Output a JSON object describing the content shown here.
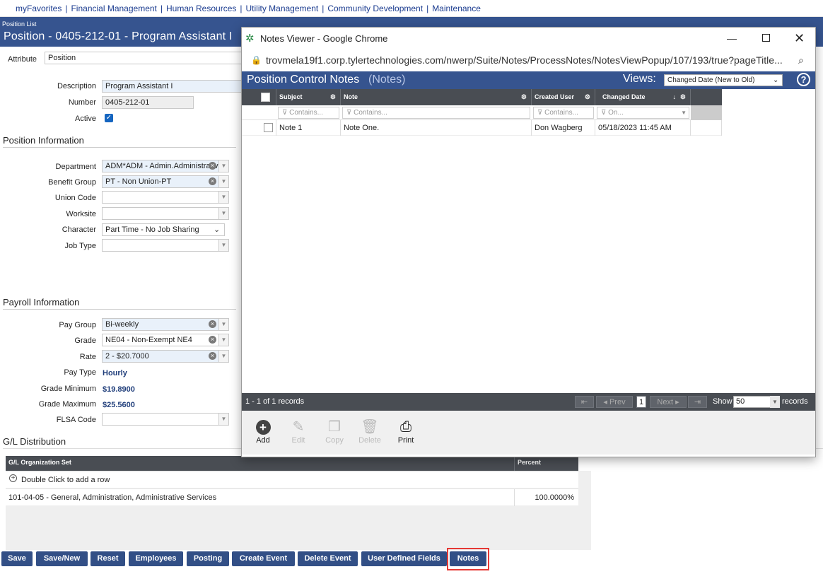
{
  "top_menu": [
    "myFavorites",
    "Financial Management",
    "Human Resources",
    "Utility Management",
    "Community Development",
    "Maintenance"
  ],
  "breadcrumb": "Position List",
  "page_title": "Position - 0405-212-01 - Program Assistant I",
  "attribute": {
    "label": "Attribute",
    "value": "Position"
  },
  "general": {
    "description_label": "Description",
    "description": "Program Assistant I",
    "number_label": "Number",
    "number": "0405-212-01",
    "active_label": "Active"
  },
  "position_info": {
    "heading": "Position Information",
    "department_label": "Department",
    "department": "ADM*ADM - Admin.Administrative",
    "benefit_label": "Benefit Group",
    "benefit": "PT - Non Union-PT",
    "union_label": "Union Code",
    "union": "",
    "worksite_label": "Worksite",
    "worksite": "",
    "character_label": "Character",
    "character": "Part Time - No Job Sharing",
    "jobtype_label": "Job Type",
    "jobtype": ""
  },
  "payroll": {
    "heading": "Payroll Information",
    "paygroup_label": "Pay Group",
    "paygroup": "Bi-weekly",
    "grade_label": "Grade",
    "grade": "NE04 - Non-Exempt NE4",
    "rate_label": "Rate",
    "rate": "2 - $20.7000",
    "paytype_label": "Pay Type",
    "paytype": "Hourly",
    "gradmin_label": "Grade Minimum",
    "gradmin": "$19.8900",
    "gradmax_label": "Grade Maximum",
    "gradmax": "$25.5600",
    "flsa_label": "FLSA Code",
    "flsa": ""
  },
  "gl": {
    "heading": "G/L Distribution",
    "col_org": "G/L Organization Set",
    "col_pct": "Percent",
    "add_row": "Double Click to add a row",
    "row_org": "101-04-05 - General, Administration, Administrative Services",
    "row_pct": "100.0000%"
  },
  "buttons": [
    "Save",
    "Save/New",
    "Reset",
    "Employees",
    "Posting",
    "Create Event",
    "Delete Event",
    "User Defined Fields",
    "Notes"
  ],
  "popup": {
    "window_title": "Notes Viewer - Google Chrome",
    "url": "trovmela19f1.corp.tylertechnologies.com/nwerp/Suite/Notes/ProcessNotes/NotesViewPopup/107/193/true?pageTitle...",
    "header_title": "Position Control Notes",
    "header_sub": "(Notes)",
    "views_label": "Views:",
    "views_value": "Changed Date (New to Old)",
    "columns": {
      "subject": "Subject",
      "note": "Note",
      "created": "Created User",
      "changed": "Changed Date"
    },
    "filters": {
      "subject": "Contains...",
      "note": "Contains...",
      "created": "Contains...",
      "changed": "On..."
    },
    "row": {
      "subject": "Note 1",
      "note": "Note One.",
      "created": "Don Wagberg",
      "changed": "05/18/2023 11:45 AM"
    },
    "paging": {
      "records": "1 - 1 of 1 records",
      "prev": "Prev",
      "page": "1",
      "next": "Next",
      "show": "Show",
      "size": "50",
      "records_suffix": "records"
    },
    "tools": {
      "add": "Add",
      "edit": "Edit",
      "copy": "Copy",
      "delete": "Delete",
      "print": "Print"
    }
  }
}
